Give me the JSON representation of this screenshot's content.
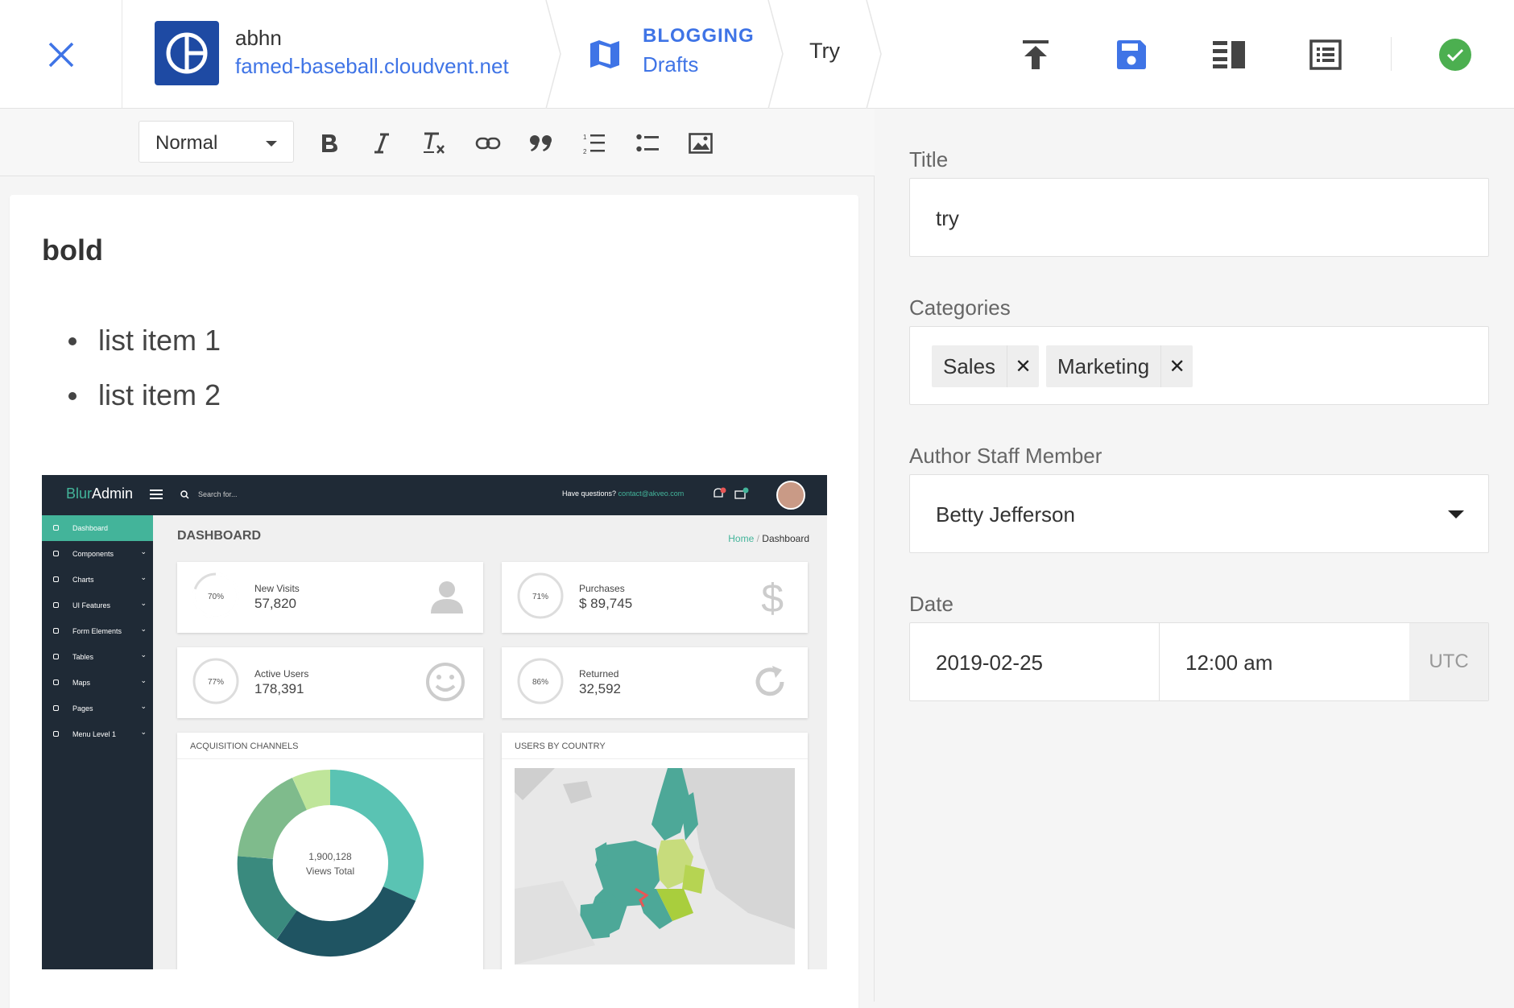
{
  "header": {
    "site_name": "abhn",
    "site_url": "famed-baseball.cloudvent.net",
    "section": "BLOGGING",
    "collection": "Drafts",
    "document": "Try",
    "icons": [
      "close-icon",
      "site-logo",
      "map-icon",
      "upload-icon",
      "save-icon",
      "split-view-icon",
      "list-view-icon",
      "check-circle-icon"
    ],
    "colors": {
      "accent": "#3f74e6",
      "success": "#4caf50"
    }
  },
  "toolbar": {
    "format_value": "Normal",
    "buttons": [
      "bold",
      "italic",
      "clear-format",
      "link",
      "blockquote",
      "ordered-list",
      "bullet-list",
      "image"
    ]
  },
  "document": {
    "heading": "bold",
    "list": [
      "list item 1",
      "list item 2"
    ]
  },
  "embedded_image": {
    "logo_a": "Blur",
    "logo_b": "Admin",
    "search_placeholder": "Search for...",
    "questions_text": "Have questions?",
    "contact_email": "contact@akveo.com",
    "page_title": "DASHBOARD",
    "breadcrumb_home": "Home",
    "breadcrumb_current": "Dashboard",
    "sidebar": [
      "Dashboard",
      "Components",
      "Charts",
      "UI Features",
      "Form Elements",
      "Tables",
      "Maps",
      "Pages",
      "Menu Level 1"
    ],
    "stats": [
      {
        "label": "New Visits",
        "value": "57,820",
        "percent": "70%"
      },
      {
        "label": "Purchases",
        "value": "$ 89,745",
        "percent": "71%"
      },
      {
        "label": "Active Users",
        "value": "178,391",
        "percent": "77%"
      },
      {
        "label": "Returned",
        "value": "32,592",
        "percent": "86%"
      }
    ],
    "acquisition_title": "ACQUISITION CHANNELS",
    "country_title": "USERS BY COUNTRY",
    "donut_value": "1,900,128",
    "donut_label": "Views Total"
  },
  "form": {
    "title_label": "Title",
    "title_value": "try",
    "categories_label": "Categories",
    "categories": [
      "Sales",
      "Marketing"
    ],
    "author_label": "Author Staff Member",
    "author_value": "Betty Jefferson",
    "date_label": "Date",
    "date_value": "2019-02-25",
    "time_value": "12:00 am",
    "timezone": "UTC"
  }
}
